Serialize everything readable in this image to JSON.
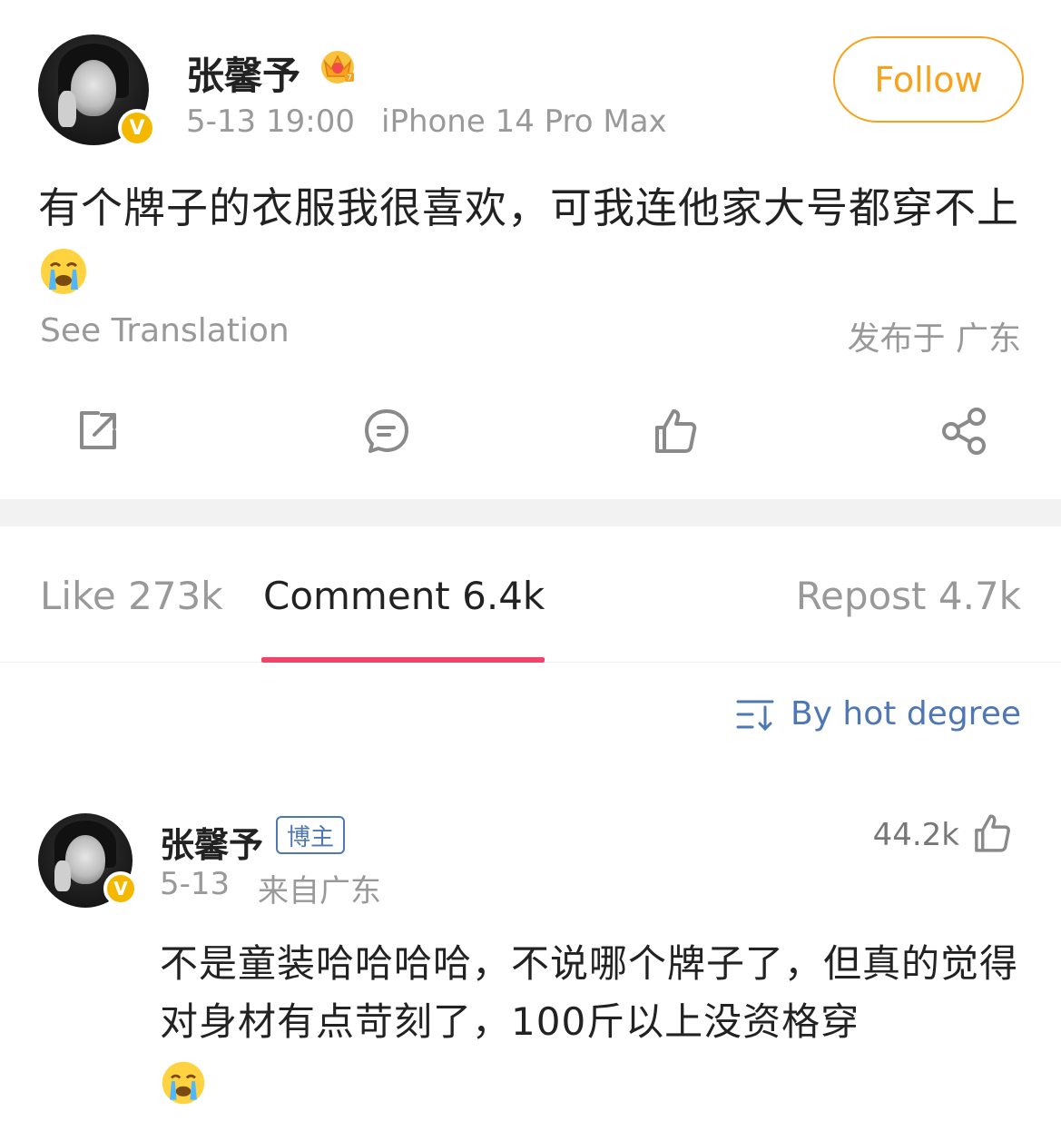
{
  "post": {
    "author": "张馨予",
    "timestamp": "5-13 19:00",
    "device": "iPhone 14 Pro Max",
    "follow_label": "Follow",
    "text": "有个牌子的衣服我很喜欢，可我连他家大号都穿不上",
    "translate_label": "See Translation",
    "location": "发布于 广东",
    "badge_icon": "crown-rank-icon",
    "verified_icon": "verified-v-badge-icon"
  },
  "actions": [
    {
      "name": "repost",
      "icon": "external-repost-icon"
    },
    {
      "name": "comment",
      "icon": "comment-bubble-icon"
    },
    {
      "name": "like",
      "icon": "thumbs-up-icon"
    },
    {
      "name": "share",
      "icon": "share-nodes-icon"
    }
  ],
  "tabs": {
    "like": "Like 273k",
    "comment": "Comment 6.4k",
    "repost": "Repost 4.7k",
    "active": "comment"
  },
  "sort": {
    "label": "By hot degree",
    "icon": "sort-icon"
  },
  "comment": {
    "author": "张馨予",
    "tag": "博主",
    "date": "5-13",
    "location": "来自广东",
    "likes": "44.2k",
    "text": "不是童装哈哈哈哈，不说哪个牌子了，但真的觉得对身材有点苛刻了，100斤以上没资格穿"
  },
  "colors": {
    "accent_orange": "#f7a21b",
    "tab_underline": "#f0446a",
    "link_blue": "#4e77b6",
    "verified_gold": "#f5b800"
  }
}
